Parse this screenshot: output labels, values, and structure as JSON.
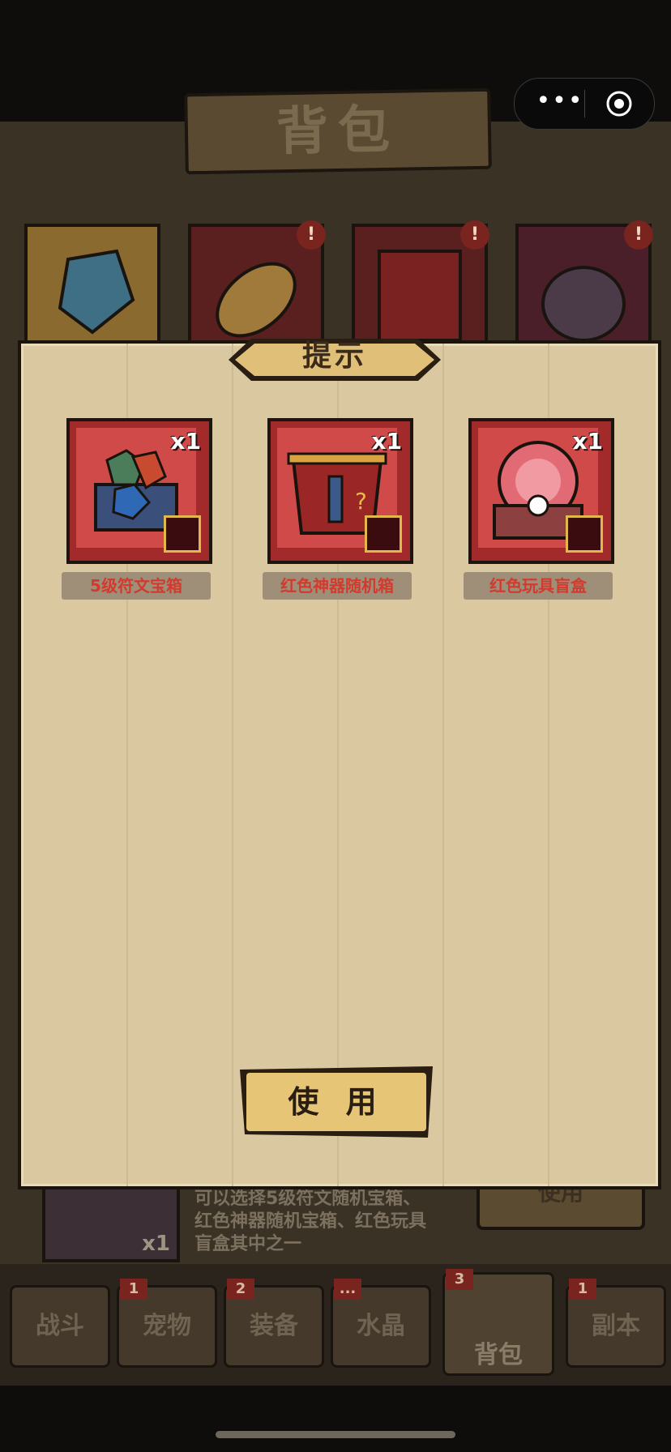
{
  "capsule": {
    "more_icon": "more-dots-icon",
    "close_icon": "target-icon"
  },
  "background": {
    "title": "背包",
    "categories": [
      {
        "name": "category-crystal",
        "color": "#b4873e",
        "badge": ""
      },
      {
        "name": "category-food",
        "color": "#7c2a2a",
        "badge": "!"
      },
      {
        "name": "category-box",
        "color": "#7c2a2a",
        "badge": "!"
      },
      {
        "name": "category-bag",
        "color": "#6a2a35",
        "badge": "!"
      }
    ],
    "bottom_item": {
      "qty": "x1",
      "desc": "可以选择5级符文随机宝箱、红色神器随机宝箱、红色玩具盲盒其中之一",
      "use_label": "使用"
    },
    "nav": [
      {
        "label": "战斗",
        "badge": ""
      },
      {
        "label": "宠物",
        "badge": "1"
      },
      {
        "label": "装备",
        "badge": "2"
      },
      {
        "label": "水晶",
        "badge": "..."
      },
      {
        "label": "背包",
        "badge": "3"
      },
      {
        "label": "副本",
        "badge": "1"
      }
    ]
  },
  "modal": {
    "title": "提示",
    "items": [
      {
        "label": "5级符文宝箱",
        "qty": "x1"
      },
      {
        "label": "红色神器随机箱",
        "qty": "x1"
      },
      {
        "label": "红色玩具盲盒",
        "qty": "x1"
      }
    ],
    "use_label": "使 用"
  },
  "colors": {
    "paper": "#d9c8a0",
    "item_red": "#d04a4a",
    "label_red": "#d33a2e",
    "button_gold": "#e7c777"
  }
}
